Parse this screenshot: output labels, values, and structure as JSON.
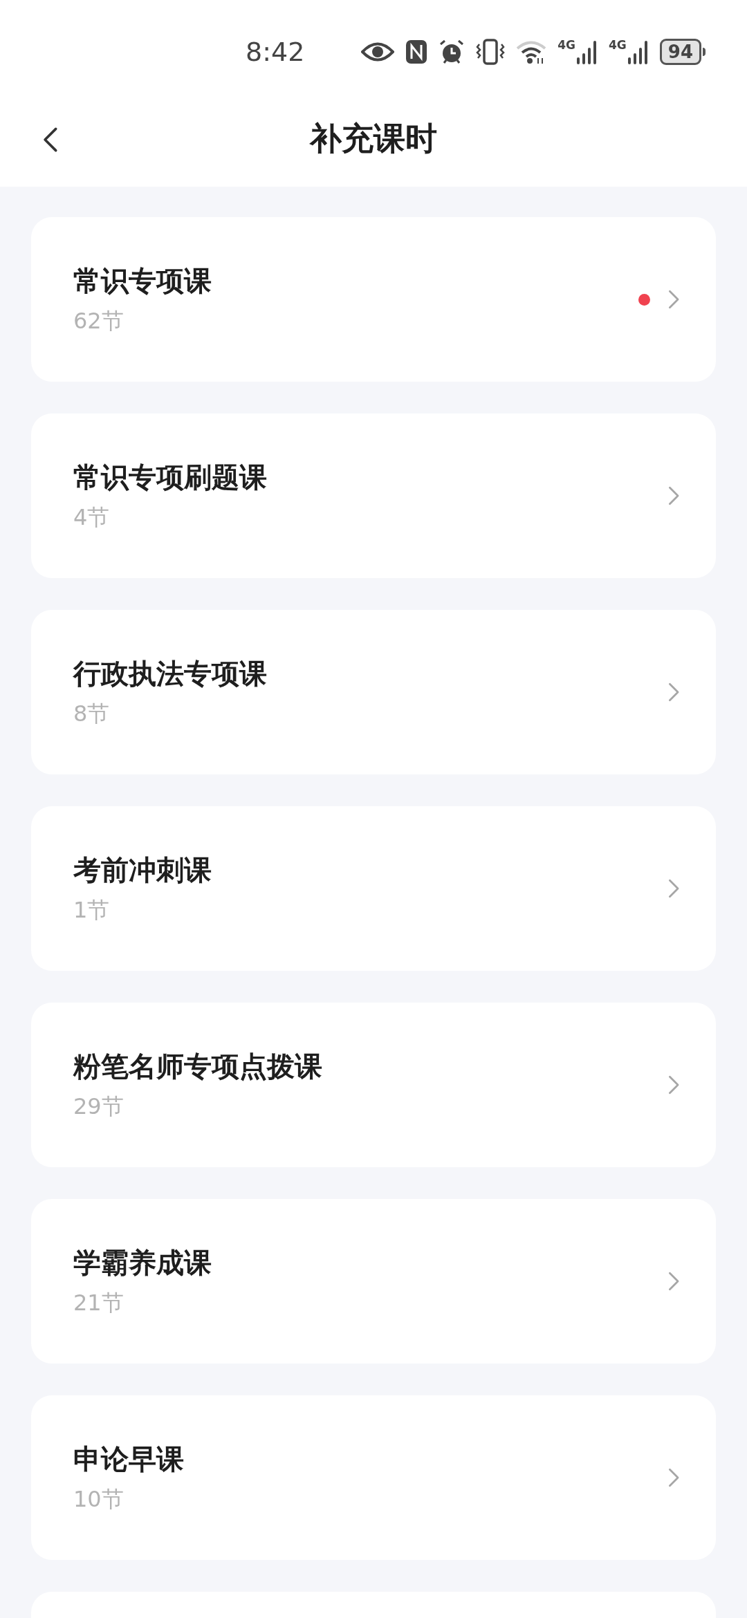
{
  "status_bar": {
    "time": "8:42",
    "network_labels": [
      "4G",
      "4G"
    ],
    "battery": "94"
  },
  "header": {
    "title": "补充课时"
  },
  "courses": [
    {
      "title": "常识专项课",
      "count": "62节",
      "unread": true
    },
    {
      "title": "常识专项刷题课",
      "count": "4节",
      "unread": false
    },
    {
      "title": "行政执法专项课",
      "count": "8节",
      "unread": false
    },
    {
      "title": "考前冲刺课",
      "count": "1节",
      "unread": false
    },
    {
      "title": "粉笔名师专项点拨课",
      "count": "29节",
      "unread": false
    },
    {
      "title": "学霸养成课",
      "count": "21节",
      "unread": false
    },
    {
      "title": "申论早课",
      "count": "10节",
      "unread": false
    }
  ],
  "partial_card": true
}
